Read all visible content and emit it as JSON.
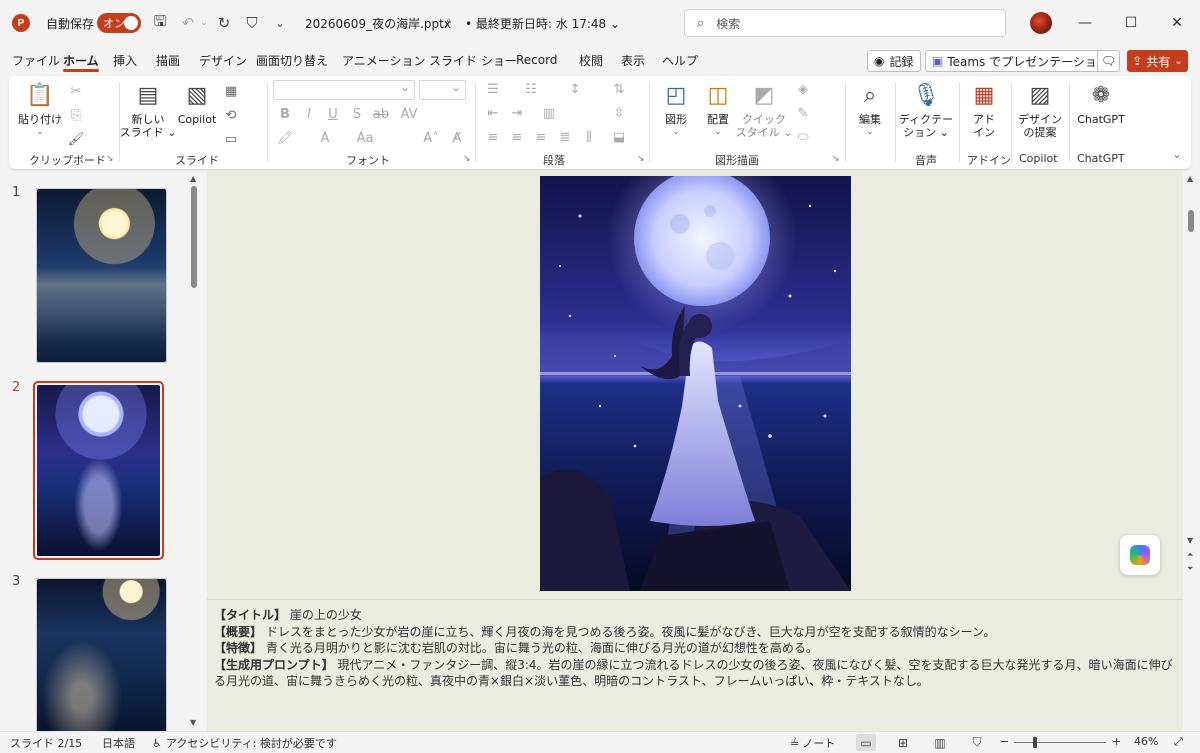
{
  "titlebar": {
    "autosave_label": "自動保存",
    "autosave_state": "オン",
    "filename": "20260609_夜の海岸.pptx",
    "save_status": "• 最終更新日時: 水 17:48 ⌄",
    "search_placeholder": "検索",
    "accent": "#c43e1c"
  },
  "tabs": [
    "ファイル",
    "ホーム",
    "挿入",
    "描画",
    "デザイン",
    "画面切り替え",
    "アニメーション",
    "スライド ショー",
    "Record",
    "校閲",
    "表示",
    "ヘルプ"
  ],
  "tab_actions": {
    "record": "記録",
    "teams": "Teams でプレゼンテーション",
    "share": "共有"
  },
  "ribbon": {
    "clipboard": {
      "paste": "貼り付け",
      "label": "クリップボード"
    },
    "slides": {
      "new_slide": "新しい",
      "new_slide_2": "スライド ⌄",
      "copilot": "Copilot",
      "label": "スライド"
    },
    "font": {
      "label": "フォント"
    },
    "paragraph": {
      "label": "段落"
    },
    "drawing": {
      "shapes": "図形",
      "arrange": "配置",
      "quick_style_1": "クイック",
      "quick_style_2": "スタイル ⌄",
      "label": "図形描画"
    },
    "editing": {
      "edit": "編集"
    },
    "voice": {
      "dictate_1": "ディクテー",
      "dictate_2": "ション ⌄",
      "label": "音声"
    },
    "addins": {
      "addin_1": "アド",
      "addin_2": "イン",
      "label": "アドイン"
    },
    "copilot_grp": {
      "designer_1": "デザイン",
      "designer_2": "の提案",
      "label": "Copilot"
    },
    "chatgpt": {
      "btn": "ChatGPT",
      "label": "ChatGPT"
    }
  },
  "thumbnails": [
    {
      "num": "1",
      "active": false
    },
    {
      "num": "2",
      "active": true
    },
    {
      "num": "3",
      "active": false
    }
  ],
  "notes": {
    "title_key": "【タイトル】",
    "title_val": "崖の上の少女",
    "summary_key": "【概要】",
    "summary_val": "ドレスをまとった少女が岩の崖に立ち、輝く月夜の海を見つめる後ろ姿。夜風に髪がなびき、巨大な月が空を支配する叙情的なシーン。",
    "feature_key": "【特徴】",
    "feature_val": "青く光る月明かりと影に沈む岩肌の対比。宙に舞う光の粒、海面に伸びる月光の道が幻想性を高める。",
    "prompt_key": "【生成用プロンプト】",
    "prompt_val": "現代アニメ・ファンタジー調、縦3:4。岩の崖の縁に立つ流れるドレスの少女の後ろ姿、夜風になびく髪、空を支配する巨大な発光する月、暗い海面に伸びる月光の道、宙に舞うきらめく光の粒、真夜中の青×銀白×淡い菫色、明暗のコントラスト、フレームいっぱい、枠・テキストなし。"
  },
  "status": {
    "slide": "スライド 2/15",
    "language": "日本語",
    "accessibility": "アクセシビリティ: 検討が必要です",
    "notes": "ノート",
    "zoom": "46%"
  }
}
